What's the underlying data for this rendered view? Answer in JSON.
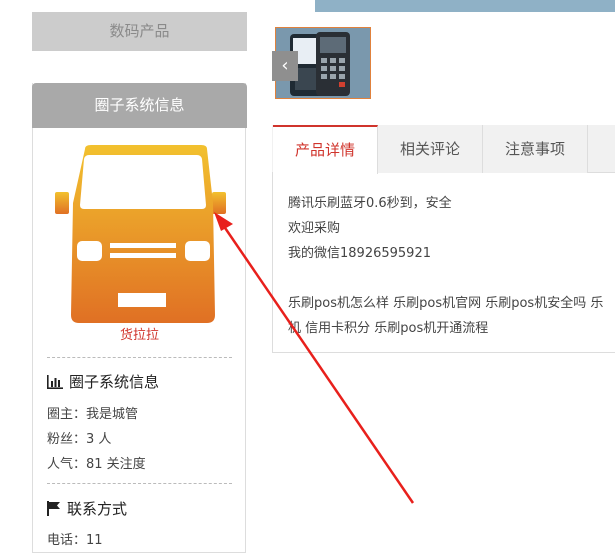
{
  "sidebar": {
    "category_button": "数码产品",
    "header_title": "圈子系统信息",
    "van_label": "货拉拉",
    "stats_title": "圈子系统信息",
    "owner": "圈主：我是城管",
    "fans": "粉丝：3 人",
    "popularity": "人气：81 关注度",
    "contact_title": "联系方式",
    "phone": "电话：11"
  },
  "product": {
    "prev_arrow": "‹",
    "tabs": [
      {
        "label": "产品详情",
        "active": true
      },
      {
        "label": "相关评论",
        "active": false
      },
      {
        "label": "注意事项",
        "active": false
      }
    ],
    "details": {
      "line1": "腾讯乐刷蓝牙0.6秒到，安全",
      "line2": "欢迎采购",
      "line3": "我的微信18926595921",
      "line4": "乐刷pos机怎么样 乐刷pos机官网 乐刷pos机安全吗 乐",
      "line5": "机 信用卡积分 乐刷pos机开通流程"
    }
  },
  "colors": {
    "accent_red": "#d0342c",
    "van_top": "#f2c12e",
    "van_bottom": "#e07024",
    "annotation_arrow": "#e8201c"
  },
  "icons": {
    "stats": "bar-chart-icon",
    "contact": "flag-icon",
    "van": "van-icon",
    "prev": "chevron-left-icon"
  }
}
